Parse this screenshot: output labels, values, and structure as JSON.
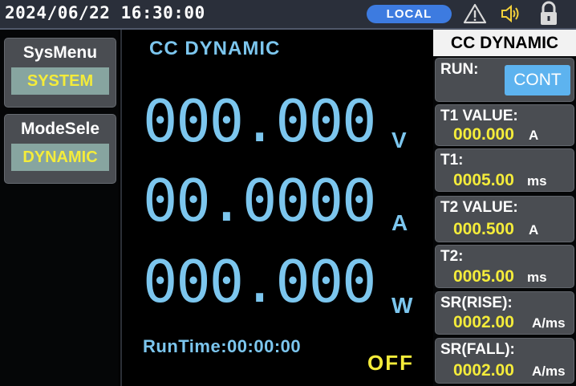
{
  "status_bar": {
    "datetime": "2024/06/22 16:30:00",
    "remote_mode": "LOCAL",
    "icons": [
      "warning-icon",
      "speaker-icon",
      "lock-icon"
    ]
  },
  "left_menu": [
    {
      "title": "SysMenu",
      "value": "SYSTEM"
    },
    {
      "title": "ModeSele",
      "value": "DYNAMIC"
    }
  ],
  "main": {
    "mode_title": "CC DYNAMIC",
    "voltage": "000.000",
    "voltage_unit": "V",
    "current": "00.0000",
    "current_unit": "A",
    "power": "000.000",
    "power_unit": "W",
    "runtime_label": "RunTime:",
    "runtime_value": "00:00:00",
    "output_state": "OFF"
  },
  "right_panel": {
    "title": "CC DYNAMIC",
    "run_label": "RUN:",
    "run_value": "CONT",
    "params": [
      {
        "label": "T1 VALUE:",
        "value": "000.000",
        "unit": "A"
      },
      {
        "label": "T1:",
        "value": "0005.00",
        "unit": "ms"
      },
      {
        "label": "T2 VALUE:",
        "value": "000.500",
        "unit": "A"
      },
      {
        "label": "T2:",
        "value": "0005.00",
        "unit": "ms"
      },
      {
        "label": "SR(RISE):",
        "value": "0002.00",
        "unit": "A/ms"
      },
      {
        "label": "SR(FALL):",
        "value": "0002.00",
        "unit": "A/ms"
      }
    ]
  },
  "colors": {
    "accent_cyan": "#7cc6ee",
    "value_yellow": "#f4ec3a",
    "badge_blue": "#3d7be0",
    "button_blue": "#5db3ef"
  }
}
